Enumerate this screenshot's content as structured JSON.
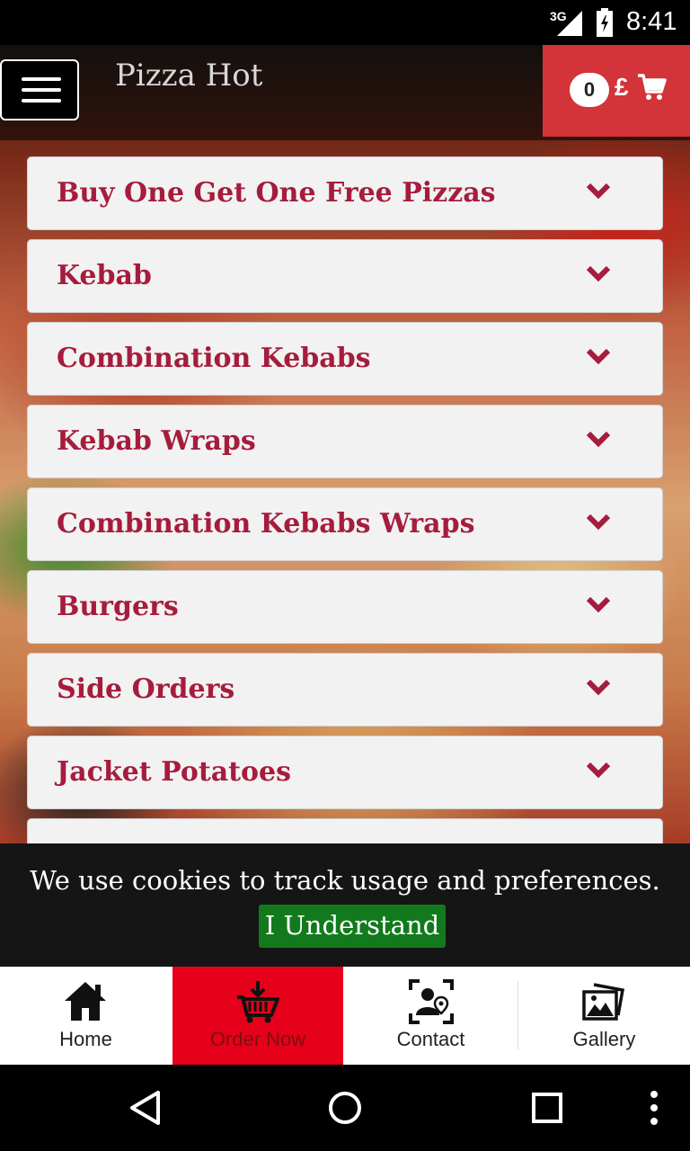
{
  "status_bar": {
    "network": "3G",
    "time": "8:41"
  },
  "header": {
    "title": "Pizza Hot",
    "cart_count": "0",
    "currency": "£"
  },
  "categories": [
    {
      "label": "Buy One Get One Free Pizzas"
    },
    {
      "label": "Kebab"
    },
    {
      "label": "Combination Kebabs"
    },
    {
      "label": "Kebab Wraps"
    },
    {
      "label": "Combination Kebabs Wraps"
    },
    {
      "label": "Burgers"
    },
    {
      "label": "Side Orders"
    },
    {
      "label": "Jacket Potatoes"
    }
  ],
  "cookie": {
    "message": "We use cookies to track usage and preferences.",
    "accept_label": "I Understand"
  },
  "tabs": [
    {
      "label": "Home",
      "icon": "home-icon"
    },
    {
      "label": "Order Now",
      "icon": "basket-icon",
      "active": true
    },
    {
      "label": "Contact",
      "icon": "contact-icon"
    },
    {
      "label": "Gallery",
      "icon": "gallery-icon"
    }
  ],
  "colors": {
    "accent_red": "#d2343a",
    "active_tab": "#e60019",
    "category_text": "#a61c3c",
    "accept_green": "#127a1c"
  }
}
